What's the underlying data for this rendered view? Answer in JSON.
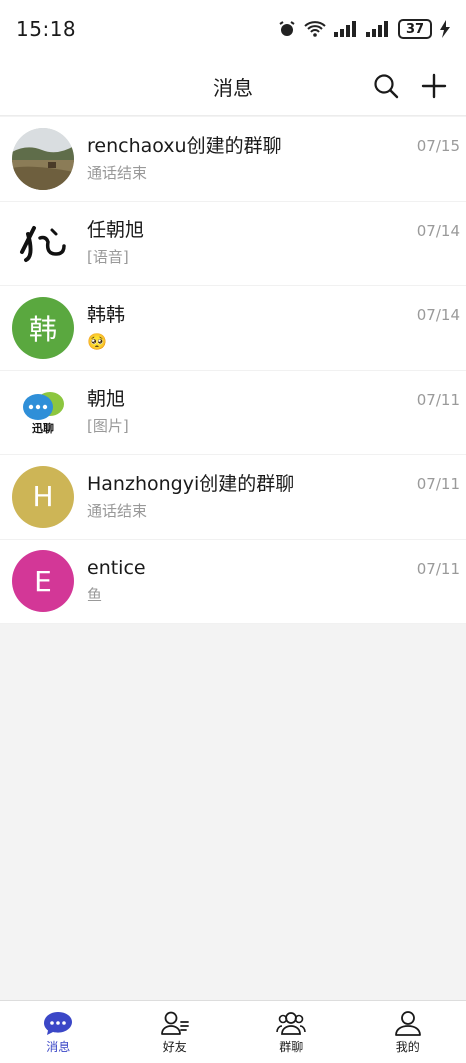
{
  "status": {
    "time": "15:18",
    "battery": "37"
  },
  "header": {
    "title": "消息"
  },
  "conversations": [
    {
      "name": "renchaoxu创建的群聊",
      "preview": "通话结束",
      "date": "07/15",
      "avatar_text": "",
      "avatar_color": ""
    },
    {
      "name": "任朝旭",
      "preview": "[语音]",
      "date": "07/14",
      "avatar_text": "",
      "avatar_color": ""
    },
    {
      "name": "韩韩",
      "preview": "🥺",
      "date": "07/14",
      "avatar_text": "韩",
      "avatar_color": "#5aa83f"
    },
    {
      "name": "朝旭",
      "preview": "[图片]",
      "date": "07/11",
      "avatar_text": "迅聊",
      "avatar_color": ""
    },
    {
      "name": "Hanzhongyi创建的群聊",
      "preview": "通话结束",
      "date": "07/11",
      "avatar_text": "H",
      "avatar_color": "#cdb556"
    },
    {
      "name": "entice",
      "preview": "鱼",
      "date": "07/11",
      "avatar_text": "E",
      "avatar_color": "#d33797"
    }
  ],
  "tabs": [
    {
      "label": "消息",
      "icon": "chat-bubble-icon",
      "active": true
    },
    {
      "label": "好友",
      "icon": "contacts-icon",
      "active": false
    },
    {
      "label": "群聊",
      "icon": "group-icon",
      "active": false
    },
    {
      "label": "我的",
      "icon": "profile-icon",
      "active": false
    }
  ],
  "colors": {
    "accent": "#3b47c7"
  }
}
